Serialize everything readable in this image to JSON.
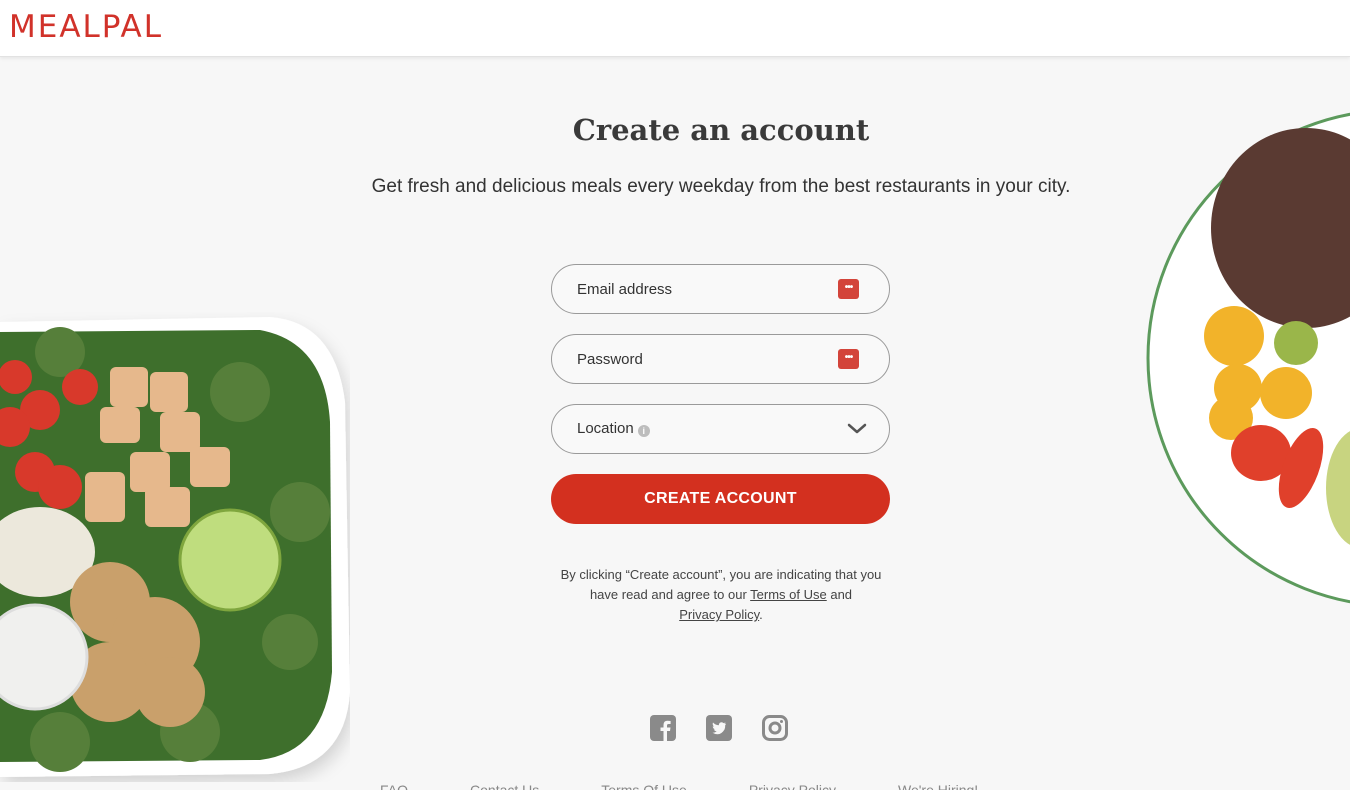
{
  "header": {
    "logo": "MEALPAL",
    "brand_color": "#d1322a"
  },
  "main": {
    "title": "Create an account",
    "subtitle": "Get fresh and delicious meals every weekday from the best restaurants in your city.",
    "form": {
      "email": {
        "placeholder": "Email address",
        "value": "",
        "icon": "password-manager-icon"
      },
      "password": {
        "placeholder": "Password",
        "value": "",
        "icon": "password-manager-icon"
      },
      "location": {
        "label": "Location",
        "info_icon": "info-icon",
        "chevron": "chevron-down-icon"
      },
      "submit_label": "CREATE ACCOUNT"
    },
    "legal": {
      "prefix": "By clicking “Create account”, you are indicating that you have read and agree to our ",
      "terms_label": "Terms of Use",
      "middle": " and ",
      "privacy_label": "Privacy Policy",
      "suffix": "."
    }
  },
  "footer": {
    "social": [
      "facebook-icon",
      "twitter-icon",
      "instagram-icon"
    ],
    "links": [
      "FAQ",
      "Contact Us",
      "Terms Of Use",
      "Privacy Policy",
      "We're Hiring!"
    ]
  },
  "images": {
    "left": "salad bowl with kale, tomatoes, chicken, lime",
    "right": "quinoa bowl with tomatoes and greens"
  }
}
